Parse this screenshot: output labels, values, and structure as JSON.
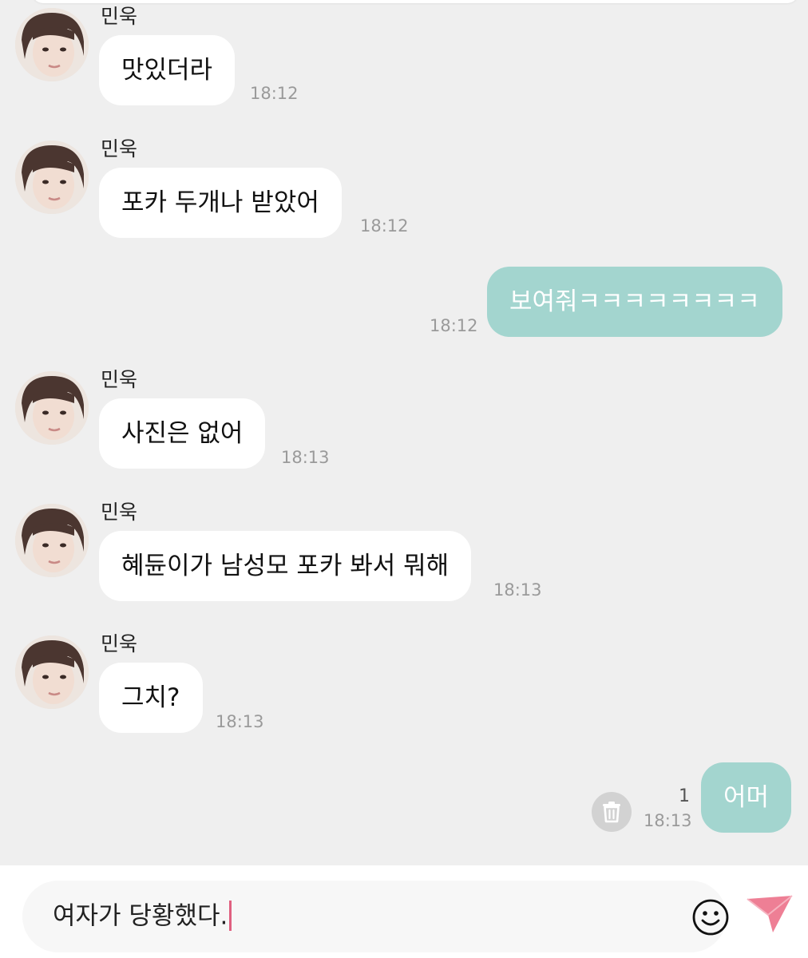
{
  "colors": {
    "background": "#efefef",
    "incoming_bubble": "#ffffff",
    "outgoing_bubble": "#a3d5cf",
    "send_icon": "#ee7f95",
    "caret": "#e06080"
  },
  "messages": [
    {
      "direction": "in",
      "sender": "민욱",
      "text": "맛있더라",
      "time": "18:12"
    },
    {
      "direction": "in",
      "sender": "민욱",
      "text": "포카 두개나 받았어",
      "time": "18:12"
    },
    {
      "direction": "out",
      "text": "보여줘ㅋㅋㅋㅋㅋㅋㅋㅋ",
      "time": "18:12"
    },
    {
      "direction": "in",
      "sender": "민욱",
      "text": "사진은 없어",
      "time": "18:13"
    },
    {
      "direction": "in",
      "sender": "민욱",
      "text": "혜듄이가 남성모 포카 봐서 뭐해",
      "time": "18:13"
    },
    {
      "direction": "in",
      "sender": "민욱",
      "text": "그치?",
      "time": "18:13"
    },
    {
      "direction": "out",
      "text": "어머",
      "time": "18:13",
      "unread": "1",
      "delete_icon": "trash-icon"
    }
  ],
  "composer": {
    "input_value": "여자가 당황했다.",
    "emoji_icon": "smiley-icon",
    "send_icon": "paper-plane-icon"
  }
}
